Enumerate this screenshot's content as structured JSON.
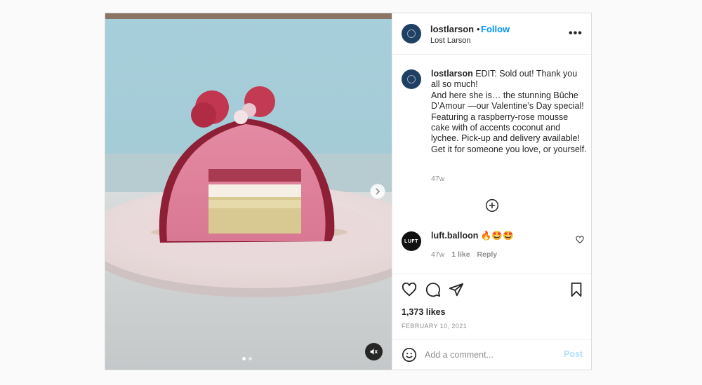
{
  "post": {
    "author": {
      "username": "lostlarson",
      "full_name": "Lost Larson",
      "separator": "•",
      "follow_label": "Follow"
    },
    "more_label": "•••",
    "caption": {
      "username": "lostlarson",
      "text": " EDIT: Sold out! Thank you all so much!\nAnd here she is… the stunning Bûche D’Amour —our Valentine’s Day special! Featuring a raspberry-rose mousse cake with of accents coconut and lychee. Pick-up and delivery available! Get it for someone you love, or yourself.",
      "time": "47w"
    },
    "comment": {
      "avatar_text": "LUFT",
      "username": "luft.balloon",
      "text": " 🔥🤩🤩",
      "time": "47w",
      "likes": "1 like",
      "reply_label": "Reply"
    },
    "likes_text": "1,373 likes",
    "date_text": "FEBRUARY 10, 2021",
    "add_comment": {
      "placeholder": "Add a comment...",
      "post_label": "Post"
    },
    "media": {
      "type": "video",
      "current_slide": 1,
      "total_slides": 2
    }
  },
  "colors": {
    "link_blue": "#0095f6",
    "post_disabled": "#b2dffc",
    "muted_text": "#8e8e8e",
    "border": "#dbdbdb"
  }
}
